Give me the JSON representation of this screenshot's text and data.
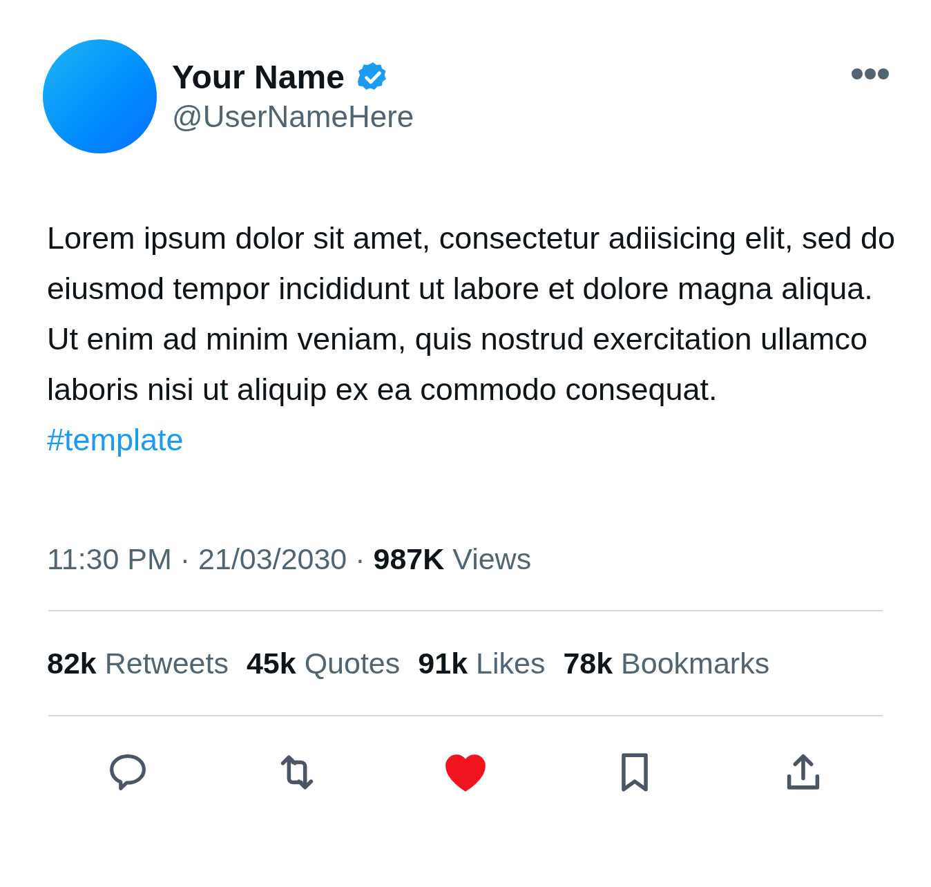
{
  "author": {
    "name": "Your Name",
    "verified": true,
    "handle": "@UserNameHere"
  },
  "body": "Lorem ipsum dolor sit amet, consectetur adiisicing elit, sed do eiusmod tempor incididunt ut labore et dolore magna aliqua. Ut enim ad minim veniam, quis nostrud exercitation ullamco laboris nisi ut aliquip ex ea commodo consequat.",
  "hashtag": "#template",
  "meta": "11:30 PM · 21/03/2030 · **987K** Views",
  "stats": [
    "**82k** Retweets",
    "**45k** Quotes",
    "**91k** Likes",
    "**78k** Bookmarks"
  ],
  "actions": [
    {
      "kind": "reply",
      "active": false
    },
    {
      "kind": "retweet",
      "active": false
    },
    {
      "kind": "like",
      "active": true
    },
    {
      "kind": "bookmark",
      "active": false
    },
    {
      "kind": "share",
      "active": false
    }
  ]
}
